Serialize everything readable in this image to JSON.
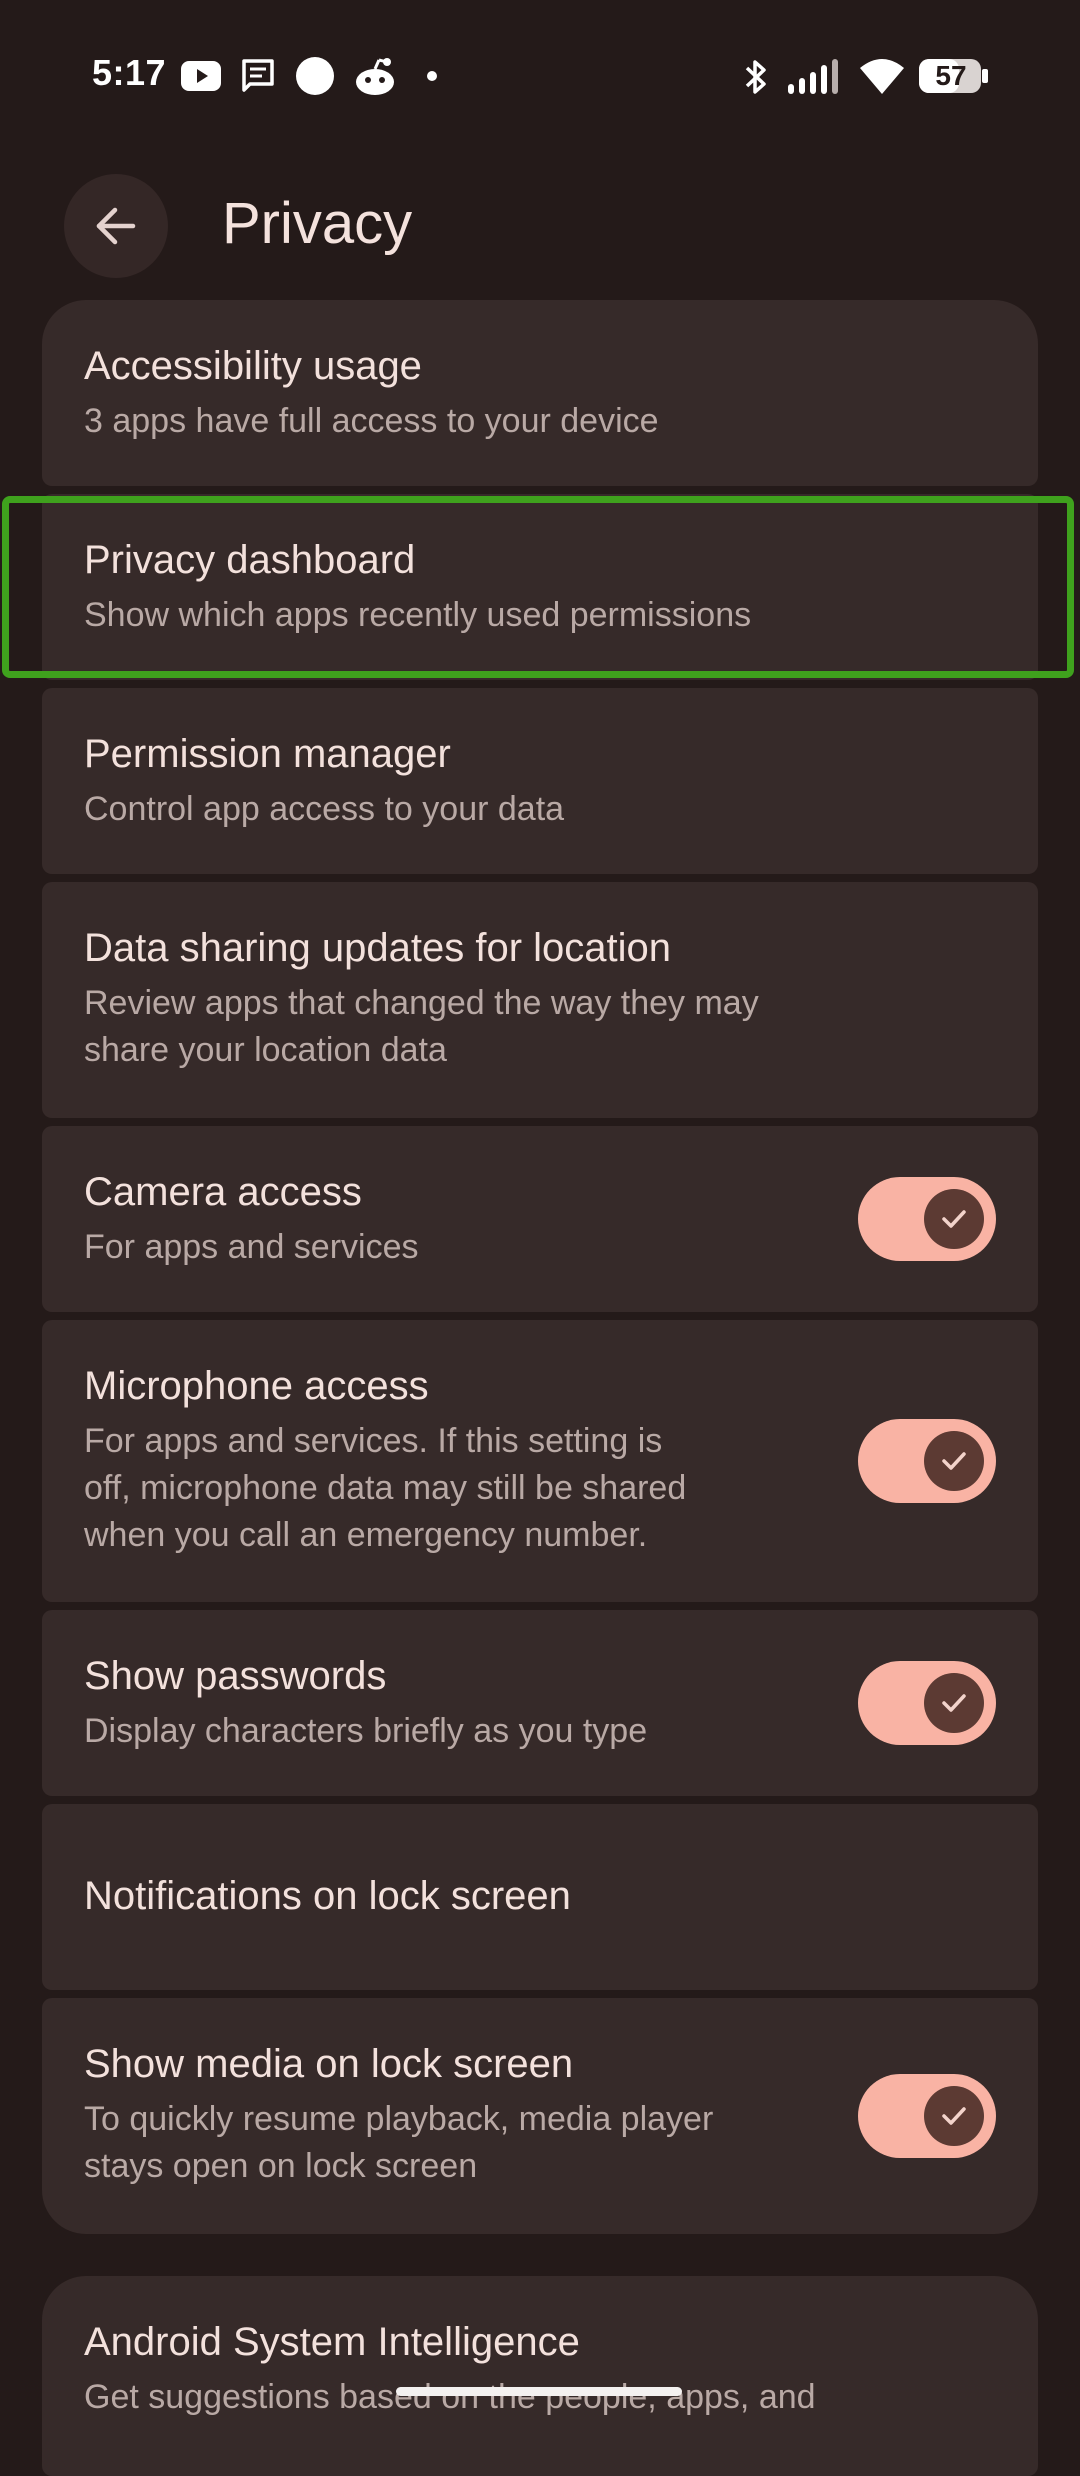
{
  "status_bar": {
    "time": "5:17",
    "battery": "57",
    "icons": [
      "youtube-icon",
      "message-icon",
      "circle-icon",
      "reddit-icon",
      "dot-icon",
      "bluetooth-icon",
      "signal-icon",
      "wifi-icon",
      "battery-icon"
    ]
  },
  "header": {
    "title": "Privacy",
    "back_icon": "arrow-back-icon"
  },
  "items": [
    {
      "title": "Accessibility usage",
      "summary": "3 apps have full access to your device"
    },
    {
      "title": "Privacy dashboard",
      "summary": "Show which apps recently used permissions",
      "highlighted": true
    },
    {
      "title": "Permission manager",
      "summary": "Control app access to your data"
    },
    {
      "title": "Data sharing updates for location",
      "summary_lines": [
        "Review apps that changed the way they may",
        "share your location data"
      ]
    },
    {
      "title": "Camera access",
      "summary": "For apps and services",
      "toggle": true
    },
    {
      "title": "Microphone access",
      "summary_lines": [
        "For apps and services. If this setting is",
        "off, microphone data may still be shared",
        "when you call an emergency number."
      ],
      "toggle": true
    },
    {
      "title": "Show passwords",
      "summary": "Display characters briefly as you type",
      "toggle": true
    },
    {
      "title": "Notifications on lock screen"
    },
    {
      "title": "Show media on lock screen",
      "summary_lines": [
        "To quickly resume playback, media player",
        "stays open on lock screen"
      ],
      "toggle": true
    }
  ],
  "next_section": {
    "title": "Android System Intelligence",
    "summary": "Get suggestions based on the people, apps, and"
  },
  "colors": {
    "background": "#241a19",
    "card": "#362a29",
    "switch_track": "#f9b3a4",
    "switch_thumb": "#5c3a33",
    "highlight": "#3fa11d"
  }
}
